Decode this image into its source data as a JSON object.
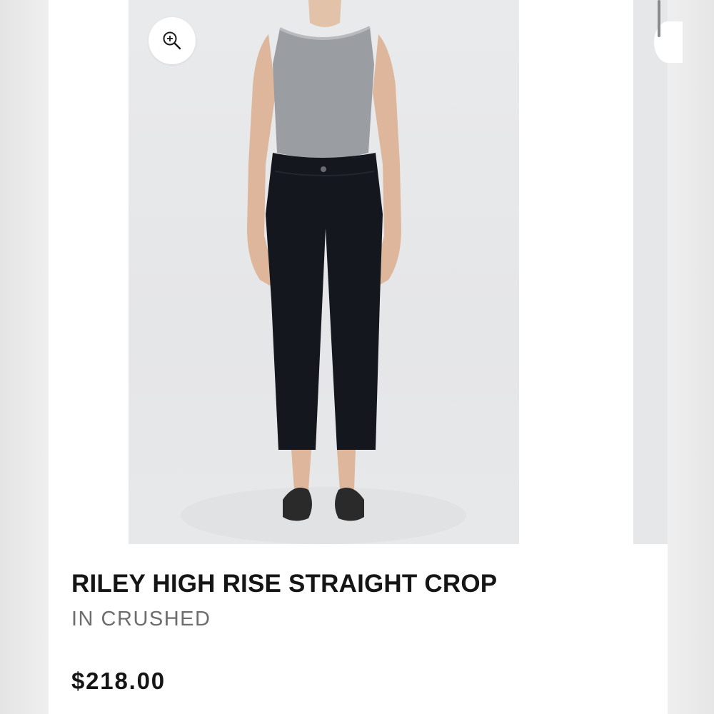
{
  "product": {
    "name": "RILEY HIGH RISE STRAIGHT CROP",
    "color_line": "IN CRUSHED",
    "price": "$218.00"
  },
  "gallery": {
    "zoom_icon": "zoom-in-icon",
    "image_subject": "model-wearing-black-jeans-and-gray-tank"
  },
  "colors": {
    "title": "#151515",
    "subtitle": "#6d6d6d",
    "image_background": "#e7e8ea"
  }
}
